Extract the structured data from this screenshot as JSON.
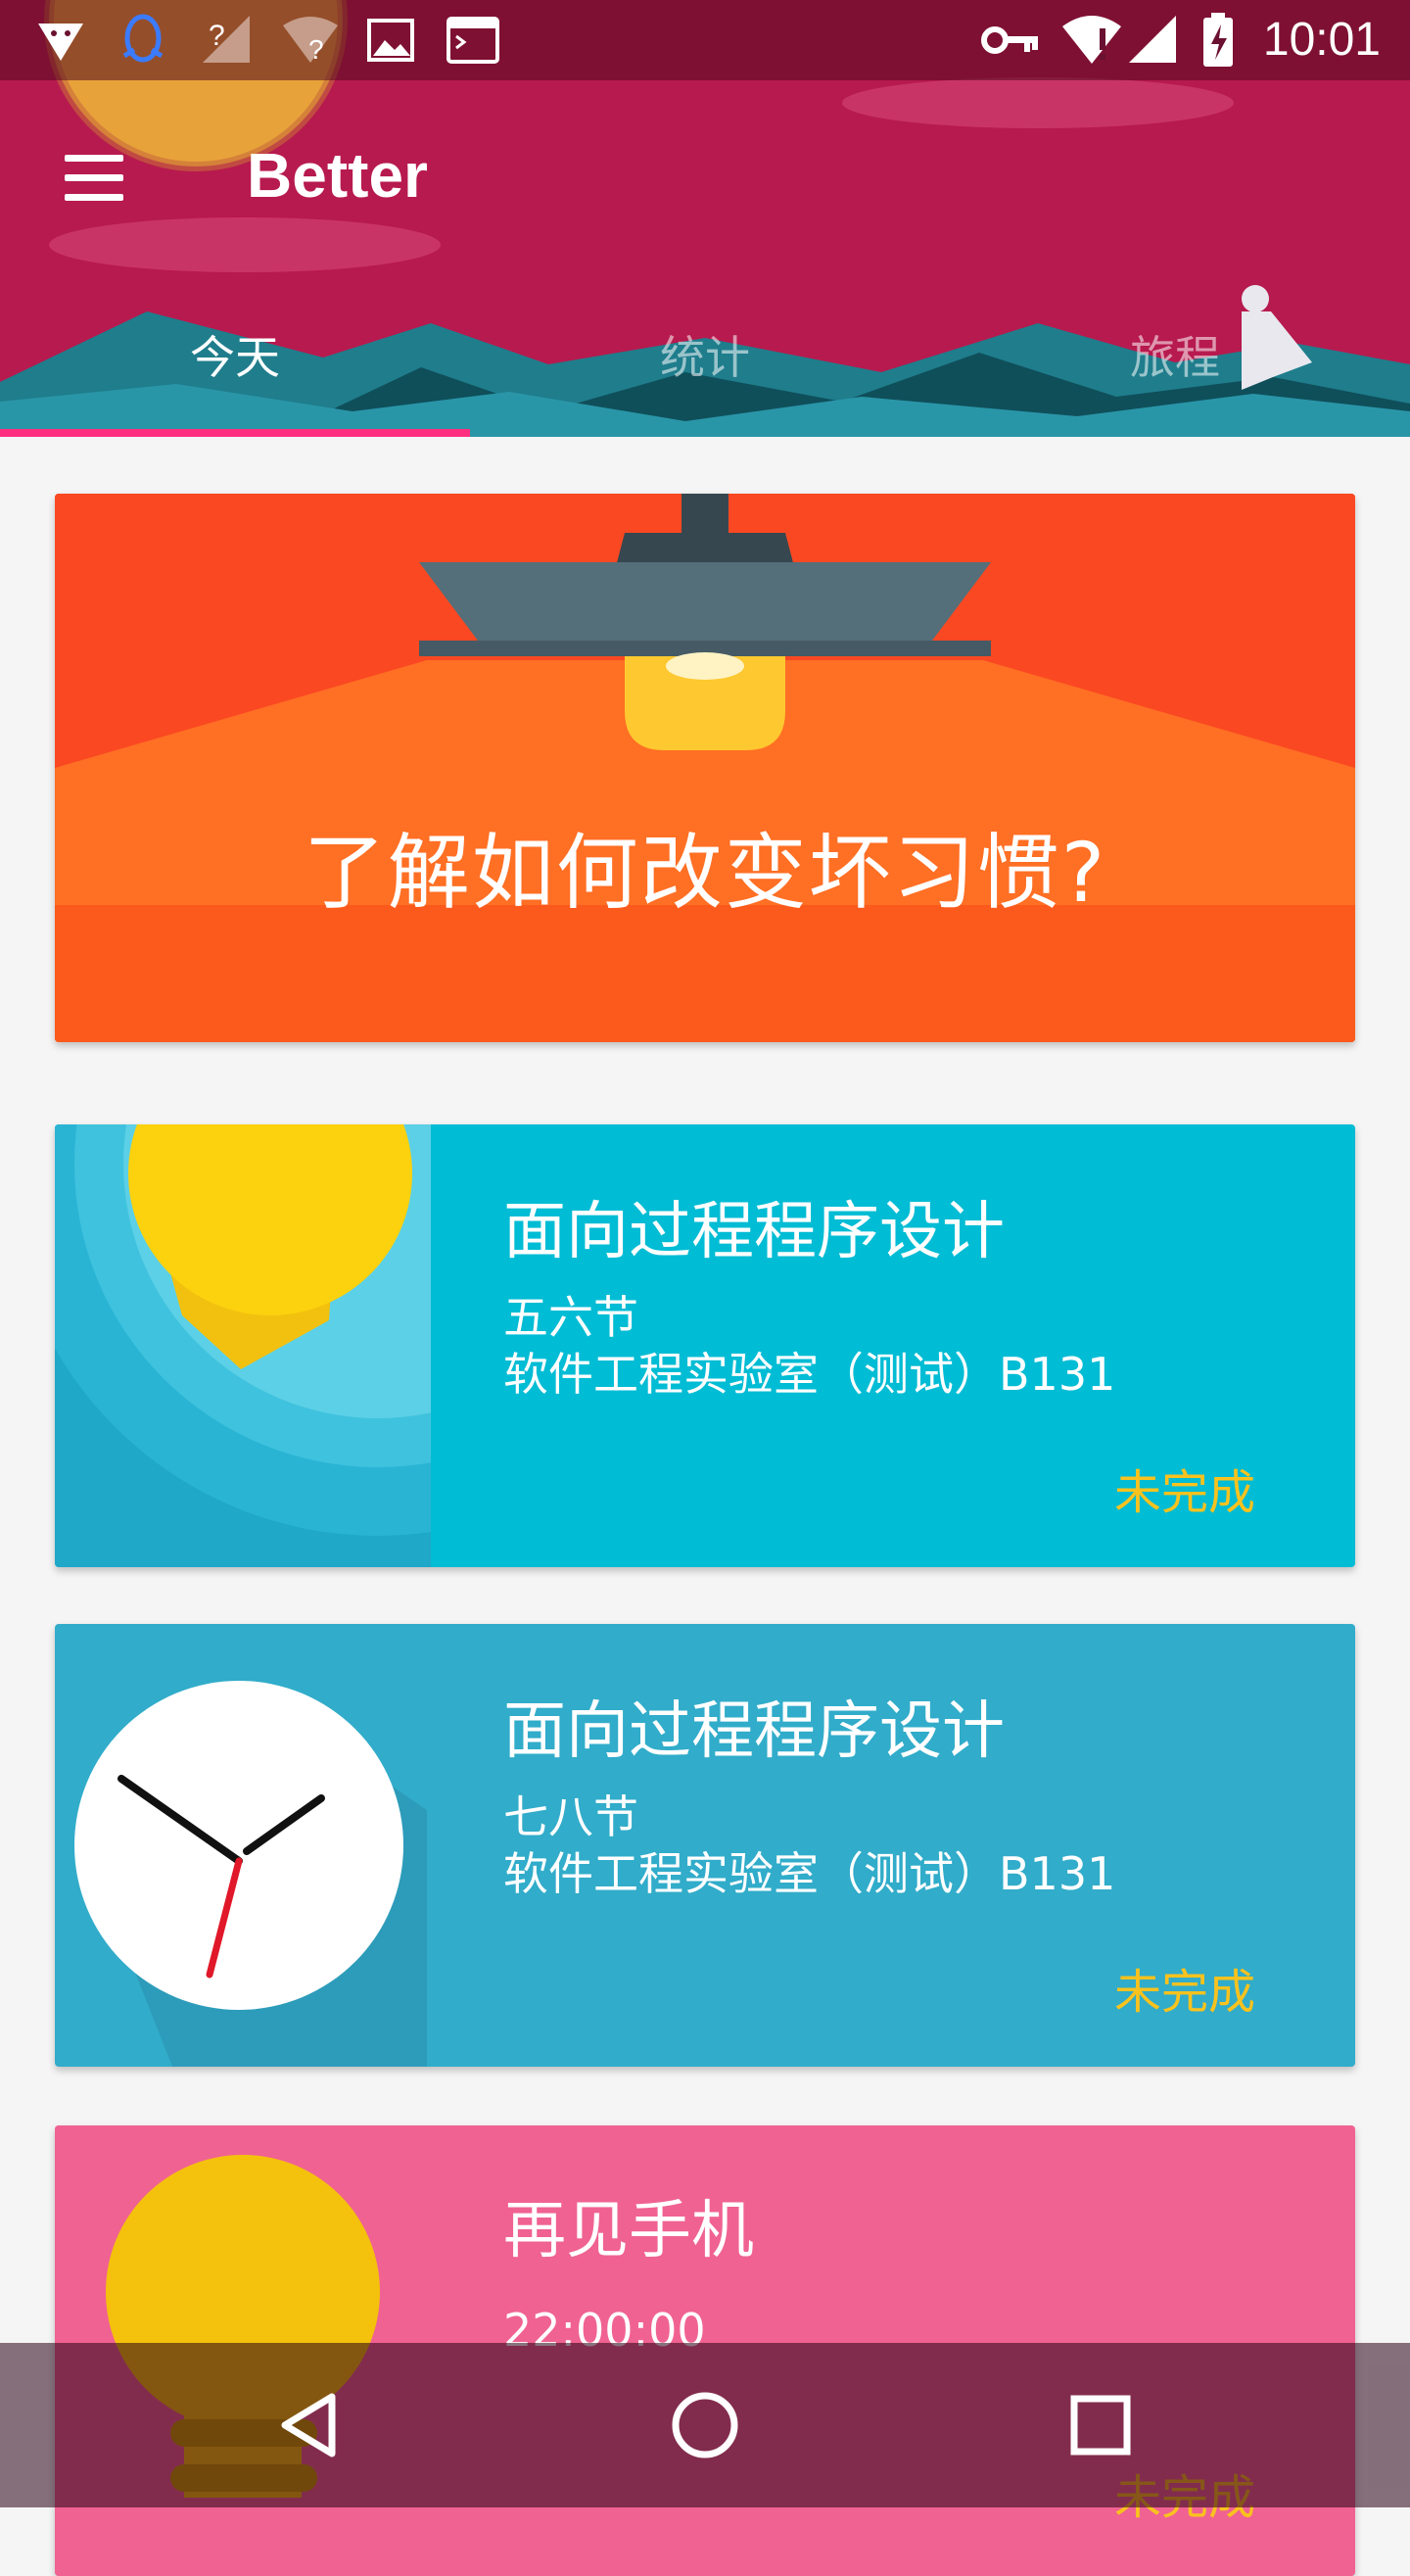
{
  "status_bar": {
    "time": "10:01",
    "icons": [
      "android-notification-icon",
      "qq-icon",
      "signal-unknown-icon",
      "wifi-unknown-icon",
      "image-icon",
      "terminal-icon",
      "key-icon",
      "wifi-alert-icon",
      "cell-signal-icon",
      "battery-charging-icon"
    ]
  },
  "app_bar": {
    "title": "Better",
    "menu_icon": "hamburger-menu-icon"
  },
  "tabs": [
    {
      "label": "今天",
      "active": true
    },
    {
      "label": "统计",
      "active": false
    },
    {
      "label": "旅程",
      "active": false
    }
  ],
  "banner": {
    "text": "了解如何改变坏习惯?"
  },
  "cards": [
    {
      "title": "面向过程程序设计",
      "line1": "五六节",
      "line2": "软件工程实验室（测试）B131",
      "status": "未完成",
      "icon": "sun-icon",
      "color": "#00bcd4"
    },
    {
      "title": "面向过程程序设计",
      "line1": "七八节",
      "line2": "软件工程实验室（测试）B131",
      "status": "未完成",
      "icon": "clock-icon",
      "color": "#31acca"
    },
    {
      "title": "再见手机",
      "line1": "22:00:00",
      "status": "未完成",
      "icon": "light-bulb-icon",
      "color": "#f06292"
    }
  ],
  "nav_bar": {
    "buttons": [
      "back-icon",
      "home-icon",
      "recents-icon"
    ]
  },
  "colors": {
    "header": "#b71a4e",
    "tab_indicator": "#ff2e7e",
    "status_text": "#f9c21e",
    "banner": "#fb4a22"
  }
}
